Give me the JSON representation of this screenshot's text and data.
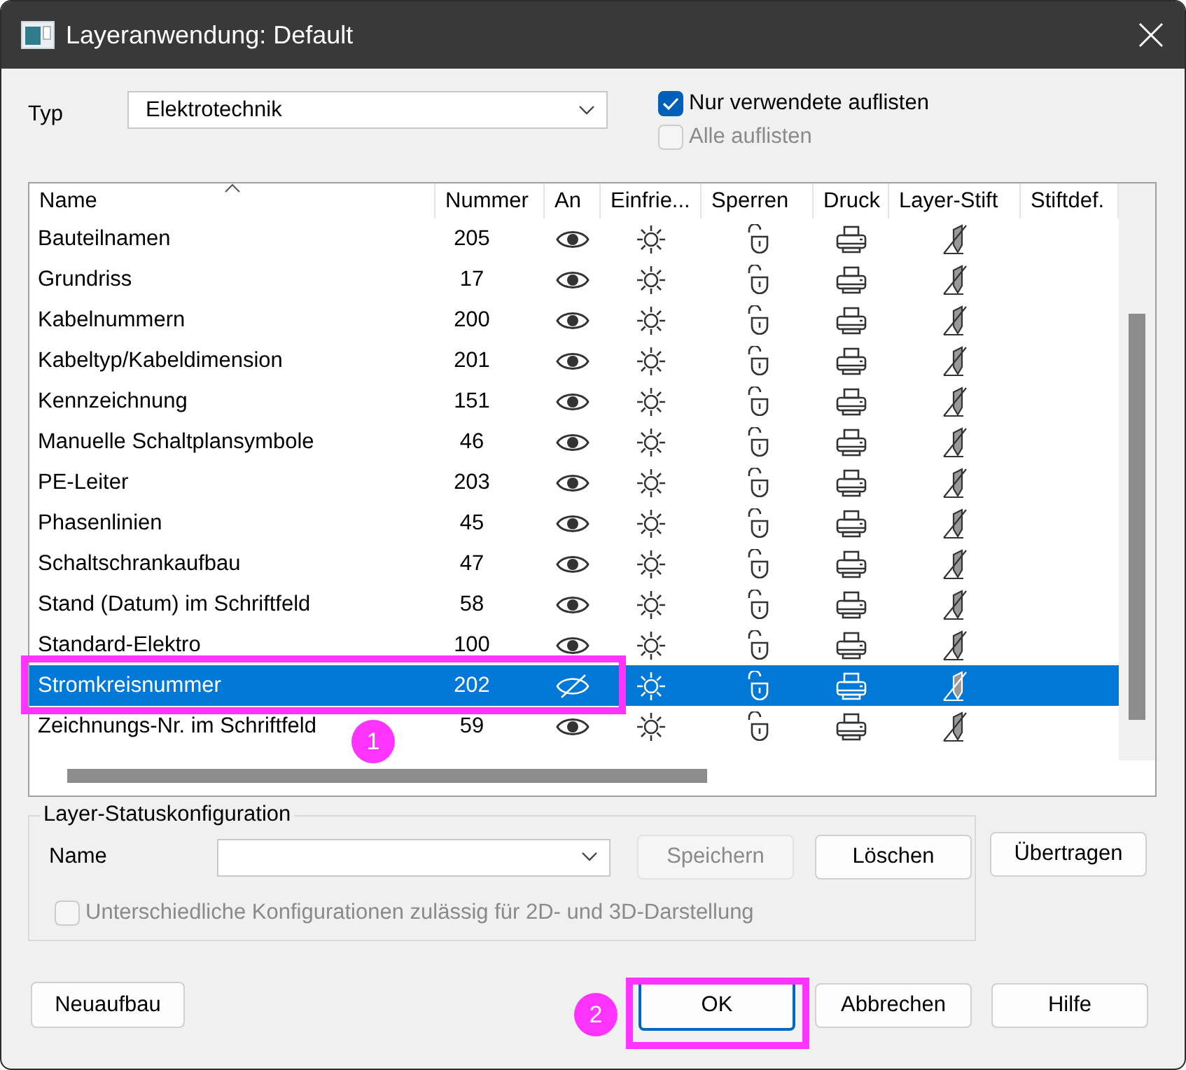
{
  "window": {
    "title": "Layeranwendung: Default"
  },
  "type_field": {
    "label": "Typ",
    "value": "Elektrotechnik"
  },
  "options": [
    {
      "label": "Nur verwendete auflisten",
      "checked": true,
      "disabled": false
    },
    {
      "label": "Alle auflisten",
      "checked": false,
      "disabled": true
    }
  ],
  "table": {
    "columns": [
      {
        "label": "Name",
        "sorted": true
      },
      {
        "label": "Nummer",
        "sorted": false
      },
      {
        "label": "An",
        "sorted": false
      },
      {
        "label": "Einfrie...",
        "sorted": false
      },
      {
        "label": "Sperren",
        "sorted": false
      },
      {
        "label": "Druck",
        "sorted": false
      },
      {
        "label": "Layer-Stift",
        "sorted": false
      },
      {
        "label": "Stiftdef.",
        "sorted": false
      }
    ],
    "rows": [
      {
        "name": "Bauteilnamen",
        "number": "205",
        "on": true,
        "selected": false
      },
      {
        "name": "Grundriss",
        "number": "17",
        "on": true,
        "selected": false
      },
      {
        "name": "Kabelnummern",
        "number": "200",
        "on": true,
        "selected": false
      },
      {
        "name": "Kabeltyp/Kabeldimension",
        "number": "201",
        "on": true,
        "selected": false
      },
      {
        "name": "Kennzeichnung",
        "number": "151",
        "on": true,
        "selected": false
      },
      {
        "name": "Manuelle Schaltplansymbole",
        "number": "46",
        "on": true,
        "selected": false
      },
      {
        "name": "PE-Leiter",
        "number": "203",
        "on": true,
        "selected": false
      },
      {
        "name": "Phasenlinien",
        "number": "45",
        "on": true,
        "selected": false
      },
      {
        "name": "Schaltschrankaufbau",
        "number": "47",
        "on": true,
        "selected": false
      },
      {
        "name": "Stand (Datum) im Schriftfeld",
        "number": "58",
        "on": true,
        "selected": false
      },
      {
        "name": "Standard-Elektro",
        "number": "100",
        "on": true,
        "selected": false
      },
      {
        "name": "Stromkreisnummer",
        "number": "202",
        "on": false,
        "selected": true
      },
      {
        "name": "Zeichnungs-Nr. im Schriftfeld",
        "number": "59",
        "on": true,
        "selected": false
      }
    ]
  },
  "status_config": {
    "title": "Layer-Statuskonfiguration",
    "name_label": "Name",
    "buttons": [
      {
        "label": "Speichern",
        "disabled": true
      },
      {
        "label": "Löschen",
        "disabled": false
      }
    ],
    "option": {
      "label": "Unterschiedliche Konfigurationen zulässig für 2D- und 3D-Darstellung",
      "checked": false,
      "disabled": true
    }
  },
  "transfer_button": {
    "label": "Übertragen"
  },
  "footer_buttons": [
    {
      "label": "Neuaufbau",
      "default": false
    },
    {
      "label": "OK",
      "default": true
    },
    {
      "label": "Abbrechen",
      "default": false
    },
    {
      "label": "Hilfe",
      "default": false
    }
  ],
  "annotations": [
    {
      "label": "1"
    },
    {
      "label": "2"
    }
  ]
}
